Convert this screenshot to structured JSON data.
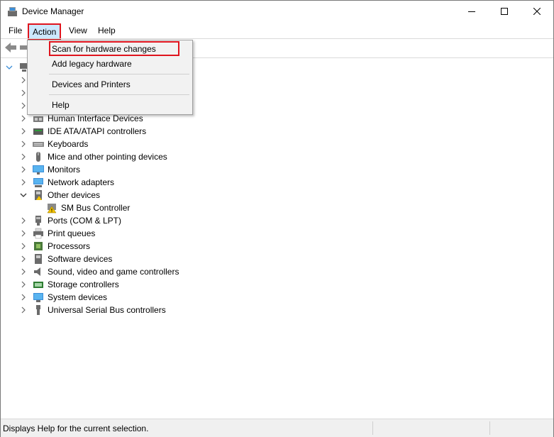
{
  "window": {
    "title": "Device Manager"
  },
  "menu": {
    "file": "File",
    "action": "Action",
    "view": "View",
    "help": "Help"
  },
  "dropdown": {
    "scan": "Scan for hardware changes",
    "legacy": "Add legacy hardware",
    "devices_printers": "Devices and Printers",
    "help": "Help"
  },
  "tree": {
    "items": [
      {
        "label": "Human Interface Devices"
      },
      {
        "label": "IDE ATA/ATAPI controllers"
      },
      {
        "label": "Keyboards"
      },
      {
        "label": "Mice and other pointing devices"
      },
      {
        "label": "Monitors"
      },
      {
        "label": "Network adapters"
      },
      {
        "label": "Other devices"
      },
      {
        "label": "SM Bus Controller"
      },
      {
        "label": "Ports (COM & LPT)"
      },
      {
        "label": "Print queues"
      },
      {
        "label": "Processors"
      },
      {
        "label": "Software devices"
      },
      {
        "label": "Sound, video and game controllers"
      },
      {
        "label": "Storage controllers"
      },
      {
        "label": "System devices"
      },
      {
        "label": "Universal Serial Bus controllers"
      }
    ]
  },
  "status": {
    "text": "Displays Help for the current selection."
  },
  "colors": {
    "highlight_border": "#e0141e",
    "menu_selected": "#cce8ff",
    "accent": "#0078d7"
  }
}
